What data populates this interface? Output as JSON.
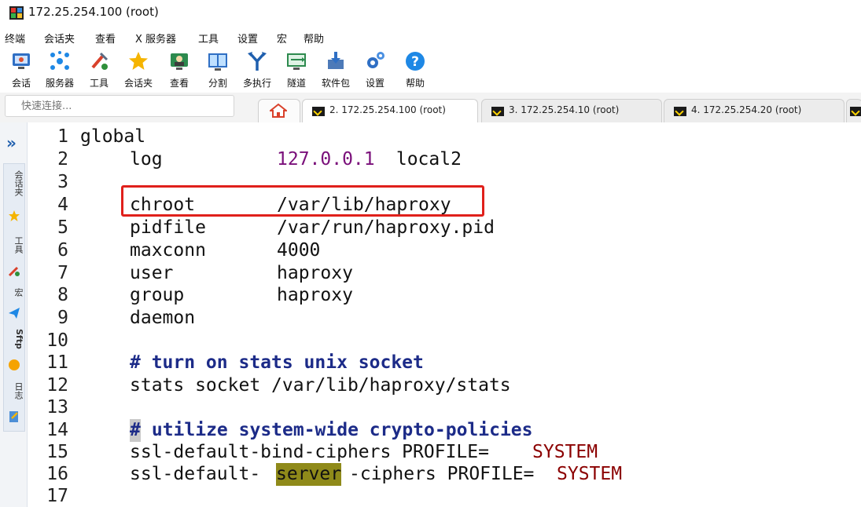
{
  "window": {
    "title": "172.25.254.100 (root)"
  },
  "menu": [
    "终端",
    "会话夹",
    "查看",
    "X 服务器",
    "工具",
    "设置",
    "宏",
    "帮助"
  ],
  "toolbar": [
    {
      "label": "会话",
      "icon": "session-icon"
    },
    {
      "label": "服务器",
      "icon": "servers-icon"
    },
    {
      "label": "工具",
      "icon": "tools-icon"
    },
    {
      "label": "会话夹",
      "icon": "star-icon"
    },
    {
      "label": "查看",
      "icon": "view-icon"
    },
    {
      "label": "分割",
      "icon": "split-icon"
    },
    {
      "label": "多执行",
      "icon": "multiexec-icon"
    },
    {
      "label": "隧道",
      "icon": "tunnel-icon"
    },
    {
      "label": "软件包",
      "icon": "packages-icon"
    },
    {
      "label": "设置",
      "icon": "settings-icon"
    },
    {
      "label": "帮助",
      "icon": "help-icon"
    }
  ],
  "quick_connect": {
    "placeholder": "快速连接..."
  },
  "tabs": [
    {
      "label": "2. 172.25.254.100 (root)",
      "active": true
    },
    {
      "label": "3. 172.25.254.10 (root)",
      "active": false
    },
    {
      "label": "4. 172.25.254.20 (root)",
      "active": false
    }
  ],
  "sidebar": {
    "labels": [
      "会话夹",
      "工具",
      "宏",
      "Sftp",
      "日志"
    ]
  },
  "code": {
    "l1": "global",
    "l2a": "log",
    "l2b": "127.0.0.1",
    "l2c": " local2",
    "l4a": "chroot",
    "l4b": "/var/lib/haproxy",
    "l5a": "pidfile",
    "l5b": "/var/run/haproxy.pid",
    "l6a": "maxconn",
    "l6b": "4000",
    "l7a": "user",
    "l7b": "haproxy",
    "l8a": "group",
    "l8b": "haproxy",
    "l9a": "daemon",
    "l11": "# turn on stats unix socket",
    "l12": "stats socket /var/lib/haproxy/stats",
    "l14a": "#",
    "l14b": " utilize system-wide crypto-policies",
    "l15a": "ssl-default-bind-ciphers PROFILE=",
    "l15b": "SYSTEM",
    "l16a": "ssl-default-",
    "l16b": "server",
    "l16c": "-ciphers PROFILE=",
    "l16d": "SYSTEM"
  },
  "line_numbers": [
    "1",
    "2",
    "3",
    "4",
    "5",
    "6",
    "7",
    "8",
    "9",
    "10",
    "11",
    "12",
    "13",
    "14",
    "15",
    "16",
    "17"
  ],
  "colors": {
    "highlight_box": "#e0201b",
    "search_highlight": "#8f8a1a",
    "accent": "#1f5fae"
  }
}
